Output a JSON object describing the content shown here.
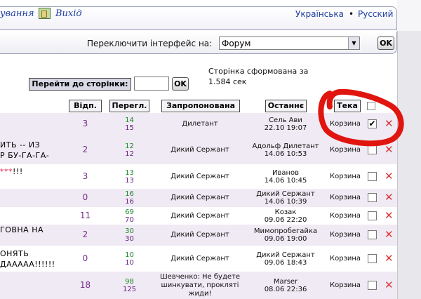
{
  "header": {
    "top_cont": "ування",
    "exit_icon": "exit-door-icon",
    "exit_label": "Вихід",
    "lang_ua": "Українська",
    "lang_sep": "•",
    "lang_ru": "Русский"
  },
  "switcher": {
    "label": "Переключити інтерфейс на:",
    "selected": "Форум",
    "ok": "OK"
  },
  "pager": {
    "goto_label": "Перейти до сторінки:",
    "goto_value": "",
    "ok": "OK",
    "generated": "Сторінка сформована за 1.584 сек"
  },
  "columns": {
    "replies": "Відп.",
    "views": "Перегл.",
    "started": "Запропонована",
    "last": "Останнє",
    "folder": "Тека"
  },
  "rows": [
    {
      "title1": "",
      "title2": "",
      "replies": "3",
      "views1": "14",
      "views2": "15",
      "starter": "Дилетант",
      "last1": "Сель Ави",
      "last2": "22.10 19:07",
      "folder": "Корзина",
      "checked": true
    },
    {
      "title1": "ИТЬ -- ИЗ",
      "title2": "Р БУ-ГА-ГА-",
      "replies": "2",
      "views1": "12",
      "views2": "12",
      "starter": "Дикий Сержант",
      "last1": "Адольф Дилетант",
      "last2": "14.06 10:53",
      "folder": "Корзина",
      "checked": false
    },
    {
      "title1": "***!!!",
      "title2": "",
      "replies": "3",
      "views1": "13",
      "views2": "13",
      "starter": "Дикий Сержант",
      "last1": "Иванов",
      "last2": "14.06 10:45",
      "folder": "Корзина",
      "checked": false
    },
    {
      "title1": "",
      "title2": "",
      "replies": "0",
      "views1": "16",
      "views2": "16",
      "starter": "Дикий Сержант",
      "last1": "Дикий Сержант",
      "last2": "14.06 10:39",
      "folder": "Корзина",
      "checked": false
    },
    {
      "title1": "",
      "title2": "",
      "replies": "11",
      "views1": "69",
      "views2": "70",
      "starter": "Дикий Сержант",
      "last1": "Козак",
      "last2": "09.06 22:20",
      "folder": "Корзина",
      "checked": false
    },
    {
      "title1": "ГОВНА НА",
      "title2": "",
      "replies": "2",
      "views1": "30",
      "views2": "30",
      "starter": "Дикий Сержант",
      "last1": "Мимопробегайка",
      "last2": "09.06 19:00",
      "folder": "Корзина",
      "checked": false
    },
    {
      "title1": "ОНЯТЬ",
      "title2": "ДААААА!!!!!!",
      "replies": "0",
      "views1": "10",
      "views2": "10",
      "starter": "Дикий Сержант",
      "last1": "Дикий Сержант",
      "last2": "09.06 18:43",
      "folder": "Корзина",
      "checked": false
    },
    {
      "title1": "",
      "title2": "",
      "replies": "18",
      "views1": "98",
      "views2": "125",
      "starter": "Шевченко: Не будете шинкувати, прокляті жиди!",
      "last1": "Marser",
      "last2": "08.06 22:36",
      "folder": "Корзина",
      "checked": false
    }
  ],
  "icons": {
    "delete": "delete-x-icon",
    "check": "checkmark-icon"
  },
  "colors": {
    "link": "#1f3fa0",
    "replies": "#7a2f8a",
    "views_top": "#1d8a2c",
    "views_bottom": "#6b1f86",
    "delete": "#d83a3a",
    "annotation": "#e0150f",
    "row_alt": "#efeaf3"
  }
}
